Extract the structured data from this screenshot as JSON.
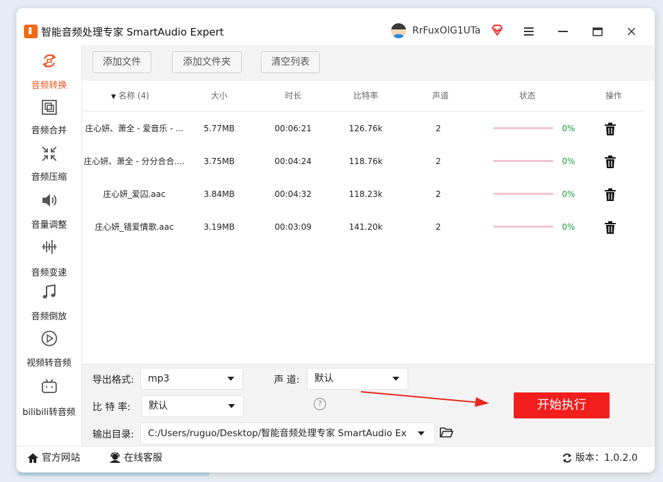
{
  "app": {
    "title": "智能音频处理专家 SmartAudio Expert",
    "user_name": "RrFuxOlG1UTa"
  },
  "sidebar": {
    "items": [
      {
        "label": "音频转换",
        "icon": "convert-icon"
      },
      {
        "label": "音频合并",
        "icon": "merge-icon"
      },
      {
        "label": "音频压缩",
        "icon": "compress-icon"
      },
      {
        "label": "音量调整",
        "icon": "volume-icon"
      },
      {
        "label": "音频变速",
        "icon": "speed-icon"
      },
      {
        "label": "音频倒放",
        "icon": "music-note-icon"
      },
      {
        "label": "视频转音频",
        "icon": "play-circle-icon"
      },
      {
        "label": "bilibili转音频",
        "icon": "bilibili-icon"
      }
    ]
  },
  "toolbar": {
    "add_file": "添加文件",
    "add_folder": "添加文件夹",
    "clear_list": "清空列表"
  },
  "table": {
    "headers": {
      "name": "名称 (4)",
      "size": "大小",
      "duration": "时长",
      "bitrate": "比特率",
      "channels": "声道",
      "status": "状态",
      "action": "操作"
    },
    "rows": [
      {
        "name": "庄心妍、萧全 - 爱音乐 - ...",
        "size": "5.77MB",
        "duration": "00:06:21",
        "bitrate": "126.76k",
        "channels": "2",
        "progress": "0%"
      },
      {
        "name": "庄心妍、萧全 - 分分合合....",
        "size": "3.75MB",
        "duration": "00:04:24",
        "bitrate": "118.76k",
        "channels": "2",
        "progress": "0%"
      },
      {
        "name": "庄心妍_爱囚.aac",
        "size": "3.84MB",
        "duration": "00:04:32",
        "bitrate": "118.23k",
        "channels": "2",
        "progress": "0%"
      },
      {
        "name": "庄心妍_错爱情歌.aac",
        "size": "3.19MB",
        "duration": "00:03:09",
        "bitrate": "141.20k",
        "channels": "2",
        "progress": "0%"
      }
    ]
  },
  "settings": {
    "format_label": "导出格式:",
    "format_value": "mp3",
    "channel_label": "声 道:",
    "channel_value": "默认",
    "bitrate_label": "比 特 率:",
    "bitrate_value": "默认",
    "output_label": "输出目录:",
    "output_value": "C:/Users/ruguo/Desktop/智能音频处理专家 SmartAudio Ex",
    "help_symbol": "?",
    "start_label": "开始执行"
  },
  "footer": {
    "website": "官方网站",
    "support": "在线客服",
    "version": "版本：1.0.2.0"
  },
  "colors": {
    "accent": "#e8531f",
    "start_button": "#f21e1e",
    "progress_track": "#f2c4cf",
    "progress_text": "#1a9a3a"
  }
}
